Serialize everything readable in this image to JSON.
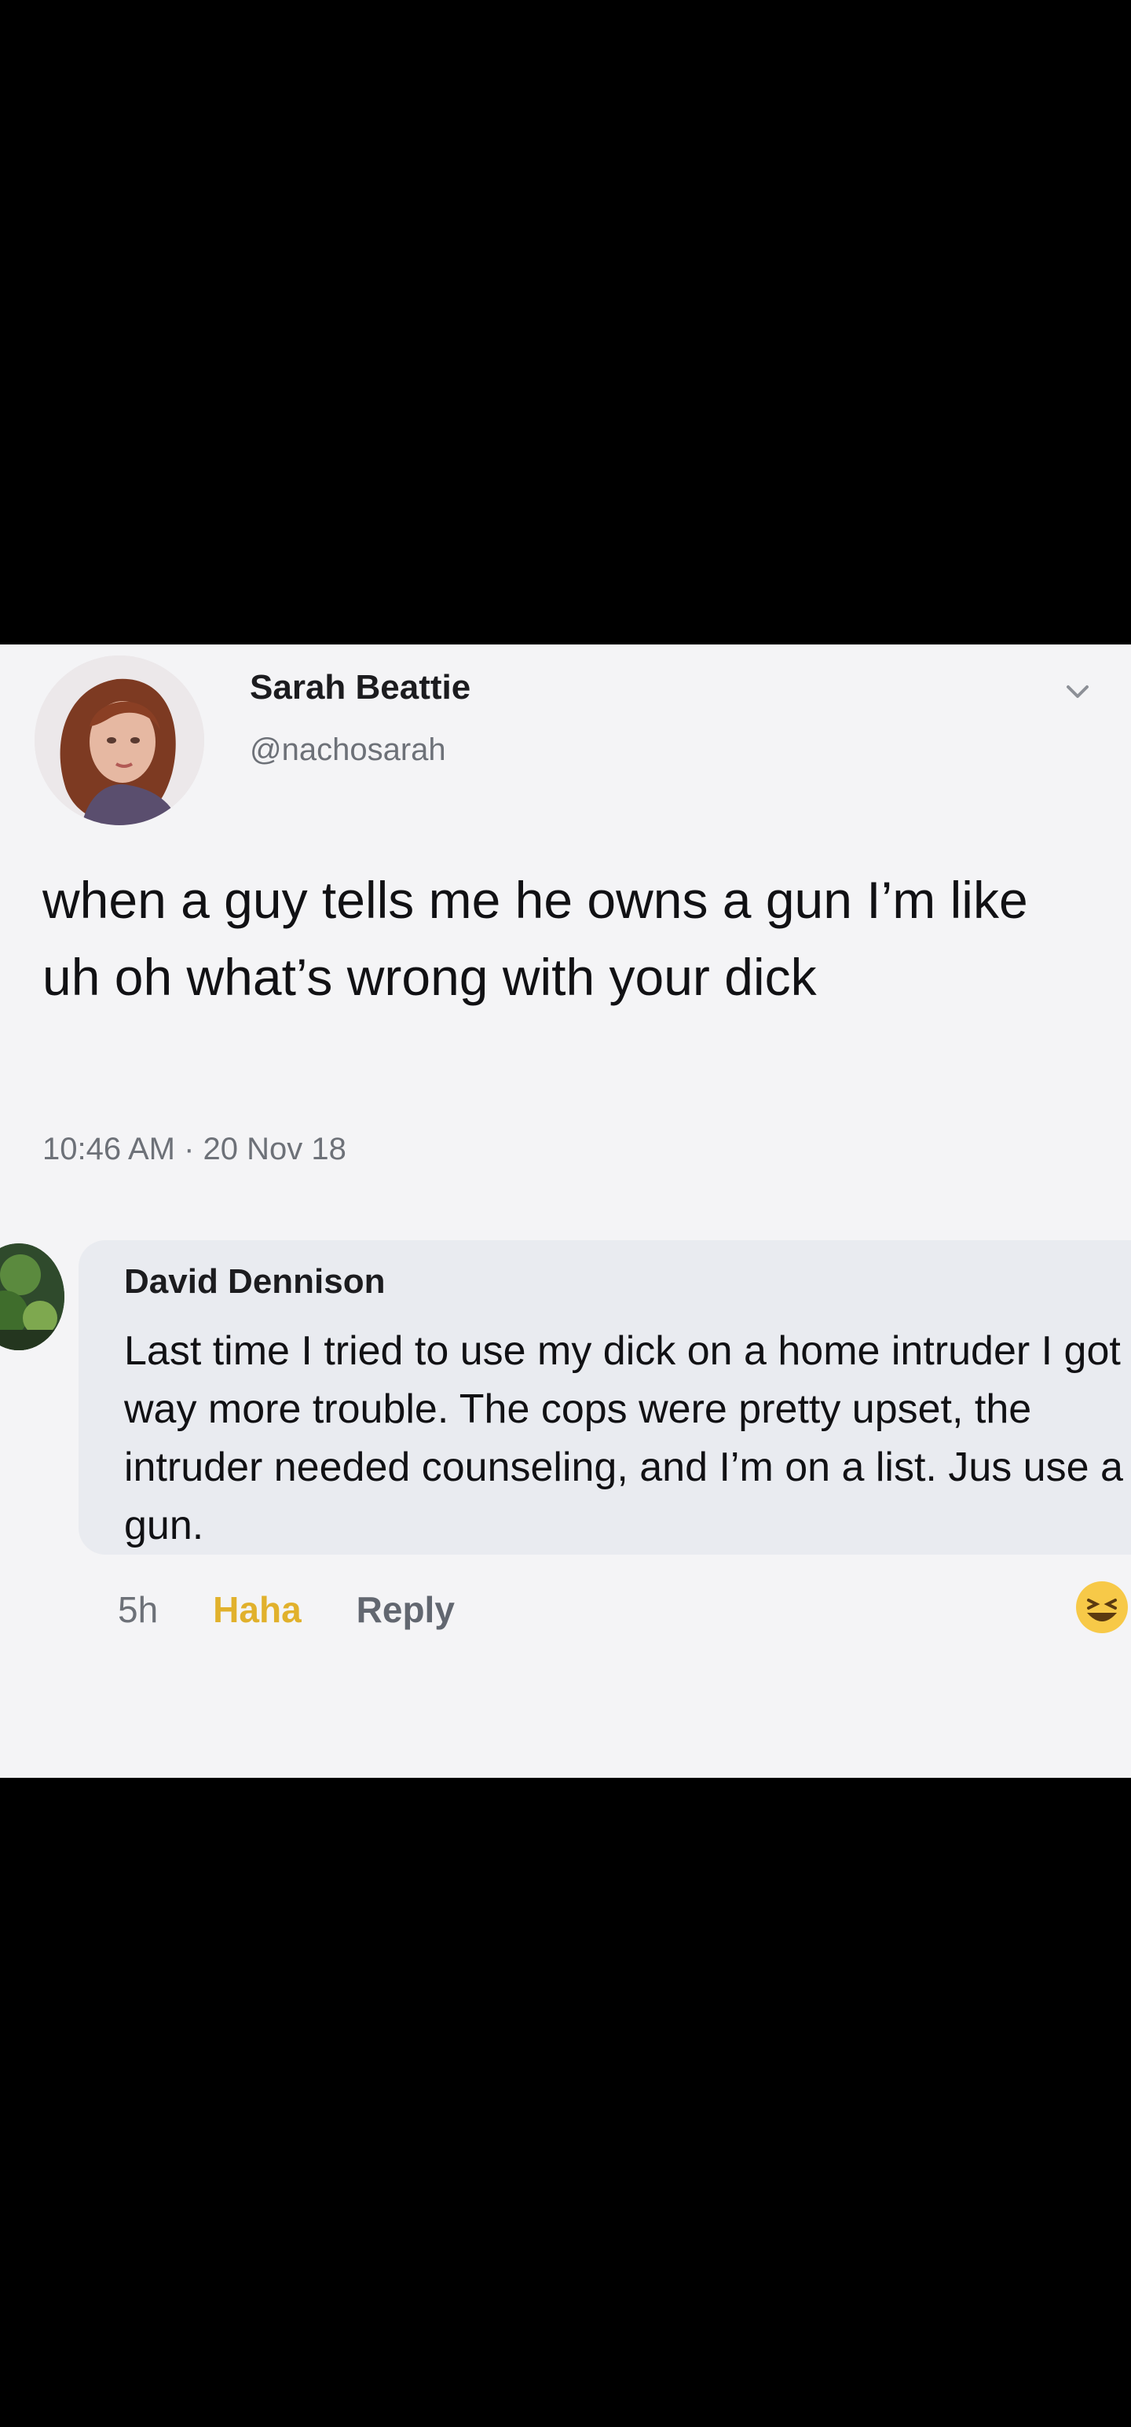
{
  "tweet": {
    "author_name": "Sarah Beattie",
    "author_handle": "@nachosarah",
    "text": "when a guy tells me he owns a gun I’m like uh oh what’s wrong with your dick",
    "timestamp": "10:46 AM · 20 Nov 18",
    "avatar_icon": "profile-photo-icon",
    "menu_icon": "chevron-down-icon"
  },
  "comment": {
    "author_name": "David Dennison",
    "text": "Last time I tried to use my dick on a home intruder I got in way more trouble. The cops were pretty upset, the intruder needed counseling, and I’m on a list. Jus use a gun.",
    "time": "5h",
    "reaction_label": "Haha",
    "reply_label": "Reply",
    "reaction_icon": "haha-emoji-icon"
  },
  "colors": {
    "background_outer": "#000000",
    "card_background": "#f4f4f6",
    "comment_bubble": "#e9ebf0",
    "haha_accent": "#e1b12c",
    "secondary_text": "#6d7178"
  }
}
